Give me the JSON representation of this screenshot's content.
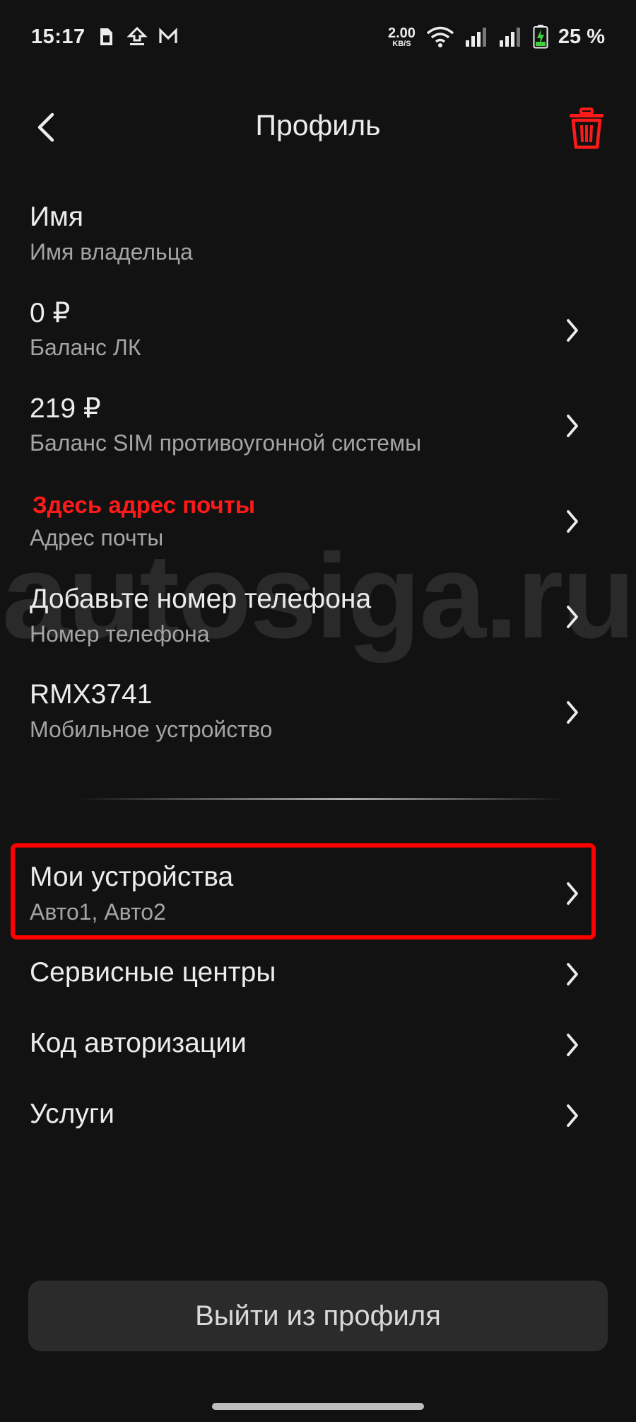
{
  "status_bar": {
    "time": "15:17",
    "net_speed_value": "2.00",
    "net_speed_unit": "KB/S",
    "battery": "25 %",
    "icons": [
      "sim-icon",
      "upload-icon",
      "mail-icon",
      "wifi-icon",
      "signal-icon",
      "signal-icon",
      "battery-charging-icon"
    ]
  },
  "header": {
    "title": "Профиль",
    "back_icon": "chevron-left-icon",
    "trash_icon": "trash-icon"
  },
  "profile": {
    "name": {
      "value": "Имя",
      "label": "Имя владельца"
    },
    "balance_lk": {
      "value": "0 ₽",
      "label": "Баланс ЛК"
    },
    "balance_sim": {
      "value": "219  ₽",
      "label": "Баланс SIM противоугонной системы"
    },
    "email": {
      "value": "Здесь адрес почты",
      "label": "Адрес почты"
    },
    "phone": {
      "value": "Добавьте номер телефона",
      "label": "Номер телефона"
    },
    "device": {
      "value": "RMX3741",
      "label": "Мобильное устройство"
    }
  },
  "menu": {
    "my_devices": {
      "label": "Мои устройства",
      "sub": "Авто1, Авто2"
    },
    "service_centers": {
      "label": "Сервисные центры"
    },
    "auth_code": {
      "label": "Код авторизации"
    },
    "services": {
      "label": "Услуги"
    }
  },
  "watermark": "autosiga.ru",
  "logout_label": "Выйти из профиля",
  "colors": {
    "background": "#121212",
    "accent_red": "#ff1a1a",
    "highlight": "#ff0000",
    "button_bg": "#2b2b2b"
  }
}
